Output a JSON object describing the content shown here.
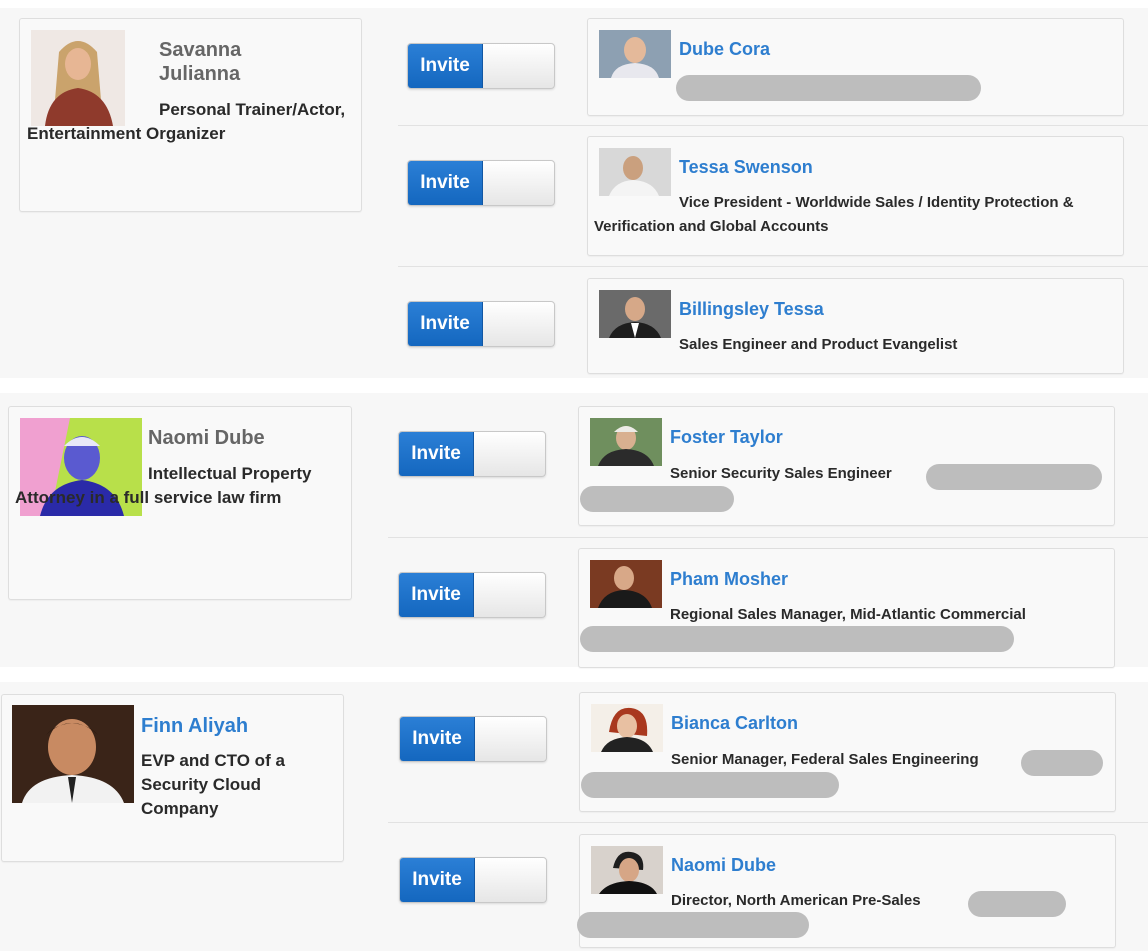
{
  "colors": {
    "invite_blue": "#1a6fcb",
    "link_blue": "#2e7ecf",
    "name_gray": "#666666",
    "redaction_gray": "#bdbdbd"
  },
  "groups": [
    {
      "source": {
        "name": "Savanna Julianna",
        "title": "Personal Trainer/Actor, Entertainment Organizer",
        "photo_icon": "person-photo"
      },
      "targets": [
        {
          "invite_label": "Invite",
          "name": "Dube Cora",
          "title": "",
          "photo_icon": "person-photo"
        },
        {
          "invite_label": "Invite",
          "name": "Tessa Swenson",
          "title": "Vice President - Worldwide Sales / Identity Protection & Verification and Global Accounts",
          "photo_icon": "person-photo"
        },
        {
          "invite_label": "Invite",
          "name": "Billingsley Tessa",
          "title": "Sales Engineer and Product Evangelist",
          "photo_icon": "person-photo"
        }
      ]
    },
    {
      "source": {
        "name": "Naomi Dube",
        "title": "Intellectual Property Attorney in a full service law firm",
        "photo_icon": "person-photo"
      },
      "targets": [
        {
          "invite_label": "Invite",
          "name": "Foster Taylor",
          "title": "Senior Security Sales Engineer",
          "photo_icon": "person-photo"
        },
        {
          "invite_label": "Invite",
          "name": "Pham Mosher",
          "title": "Regional Sales Manager, Mid-Atlantic Commercial",
          "photo_icon": "person-photo"
        }
      ]
    },
    {
      "source": {
        "name": "Finn Aliyah",
        "title": "EVP and CTO of a Security Cloud Company",
        "photo_icon": "person-photo"
      },
      "targets": [
        {
          "invite_label": "Invite",
          "name": "Bianca Carlton",
          "title": "Senior Manager, Federal Sales Engineering",
          "photo_icon": "person-photo"
        },
        {
          "invite_label": "Invite",
          "name": "Naomi Dube",
          "title": "Director, North American Pre-Sales",
          "photo_icon": "person-photo"
        }
      ]
    }
  ]
}
